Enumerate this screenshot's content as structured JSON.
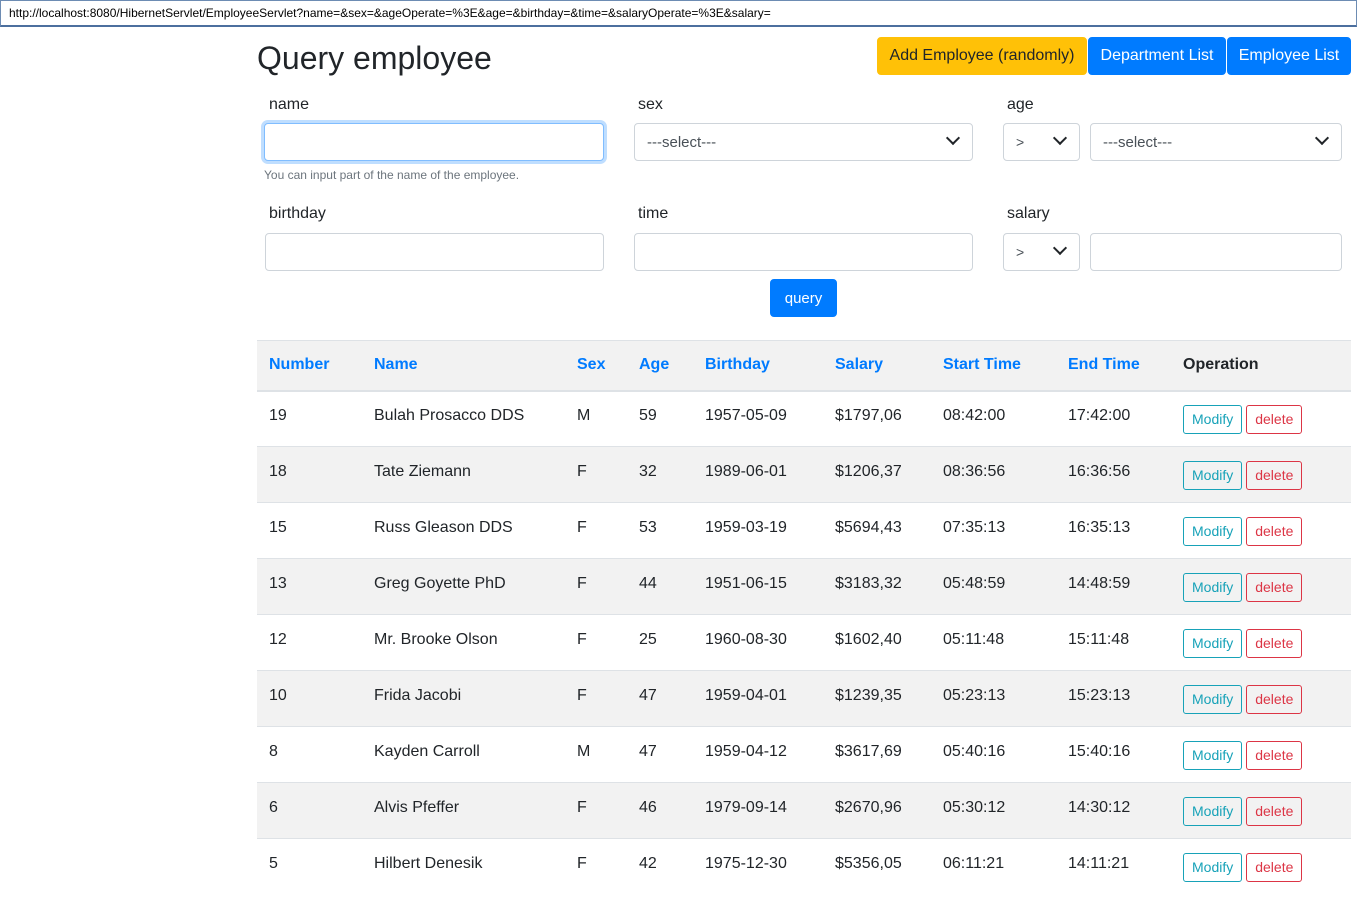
{
  "browser": {
    "url": "http://localhost:8080/HibernetServlet/EmployeeServlet?name=&sex=&ageOperate=%3E&age=&birthday=&time=&salaryOperate=%3E&salary="
  },
  "page": {
    "title": "Query employee"
  },
  "actions": {
    "add_random": "Add Employee (randomly)",
    "department_list": "Department List",
    "employee_list": "Employee List"
  },
  "form": {
    "name_label": "name",
    "name_value": "",
    "name_help": "You can input part of the name of the employee.",
    "sex_label": "sex",
    "sex_selected": "---select---",
    "age_label": "age",
    "age_operator": ">",
    "age_selected": "---select---",
    "birthday_label": "birthday",
    "birthday_value": "",
    "time_label": "time",
    "time_value": "",
    "salary_label": "salary",
    "salary_operator": ">",
    "salary_value": "",
    "query_button": "query"
  },
  "table": {
    "headers": {
      "number": "Number",
      "name": "Name",
      "sex": "Sex",
      "age": "Age",
      "birthday": "Birthday",
      "salary": "Salary",
      "start_time": "Start Time",
      "end_time": "End Time",
      "operation": "Operation"
    },
    "modify_label": "Modify",
    "delete_label": "delete",
    "rows": [
      {
        "number": "19",
        "name": "Bulah Prosacco DDS",
        "sex": "M",
        "age": "59",
        "birthday": "1957-05-09",
        "salary": "$1797,06",
        "start": "08:42:00",
        "end": "17:42:00"
      },
      {
        "number": "18",
        "name": "Tate Ziemann",
        "sex": "F",
        "age": "32",
        "birthday": "1989-06-01",
        "salary": "$1206,37",
        "start": "08:36:56",
        "end": "16:36:56"
      },
      {
        "number": "15",
        "name": "Russ Gleason DDS",
        "sex": "F",
        "age": "53",
        "birthday": "1959-03-19",
        "salary": "$5694,43",
        "start": "07:35:13",
        "end": "16:35:13"
      },
      {
        "number": "13",
        "name": "Greg Goyette PhD",
        "sex": "F",
        "age": "44",
        "birthday": "1951-06-15",
        "salary": "$3183,32",
        "start": "05:48:59",
        "end": "14:48:59"
      },
      {
        "number": "12",
        "name": "Mr. Brooke Olson",
        "sex": "F",
        "age": "25",
        "birthday": "1960-08-30",
        "salary": "$1602,40",
        "start": "05:11:48",
        "end": "15:11:48"
      },
      {
        "number": "10",
        "name": "Frida Jacobi",
        "sex": "F",
        "age": "47",
        "birthday": "1959-04-01",
        "salary": "$1239,35",
        "start": "05:23:13",
        "end": "15:23:13"
      },
      {
        "number": "8",
        "name": "Kayden Carroll",
        "sex": "M",
        "age": "47",
        "birthday": "1959-04-12",
        "salary": "$3617,69",
        "start": "05:40:16",
        "end": "15:40:16"
      },
      {
        "number": "6",
        "name": "Alvis Pfeffer",
        "sex": "F",
        "age": "46",
        "birthday": "1979-09-14",
        "salary": "$2670,96",
        "start": "05:30:12",
        "end": "14:30:12"
      },
      {
        "number": "5",
        "name": "Hilbert Denesik",
        "sex": "F",
        "age": "42",
        "birthday": "1975-12-30",
        "salary": "$5356,05",
        "start": "06:11:21",
        "end": "14:11:21"
      }
    ]
  }
}
